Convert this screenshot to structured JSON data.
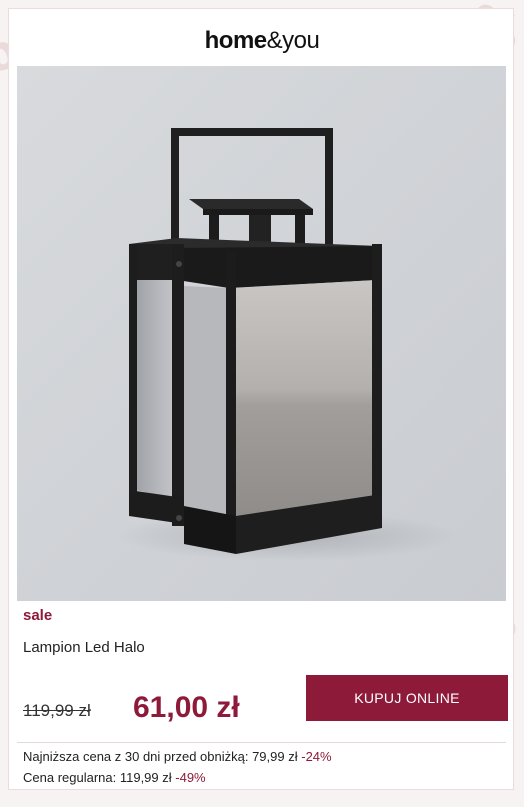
{
  "brand": {
    "bold_part": "home",
    "light_part": "&you"
  },
  "product": {
    "image_alt": "Lampion Led Halo",
    "badge": "sale",
    "name": "Lampion Led Halo",
    "old_price": "119,99 zł",
    "new_price": "61,00 zł",
    "buy_label": "KUPUJ ONLINE"
  },
  "pricing_info": {
    "lowest_label": "Najniższa cena z 30 dni przed obniżką: 79,99 zł",
    "lowest_pct": "-24%",
    "regular_label": "Cena regularna: 119,99 zł",
    "regular_pct": "-49%"
  },
  "decoration": {
    "percent_symbol": "%"
  },
  "colors": {
    "accent": "#8e1a3a",
    "background": "#f7f3f3"
  }
}
